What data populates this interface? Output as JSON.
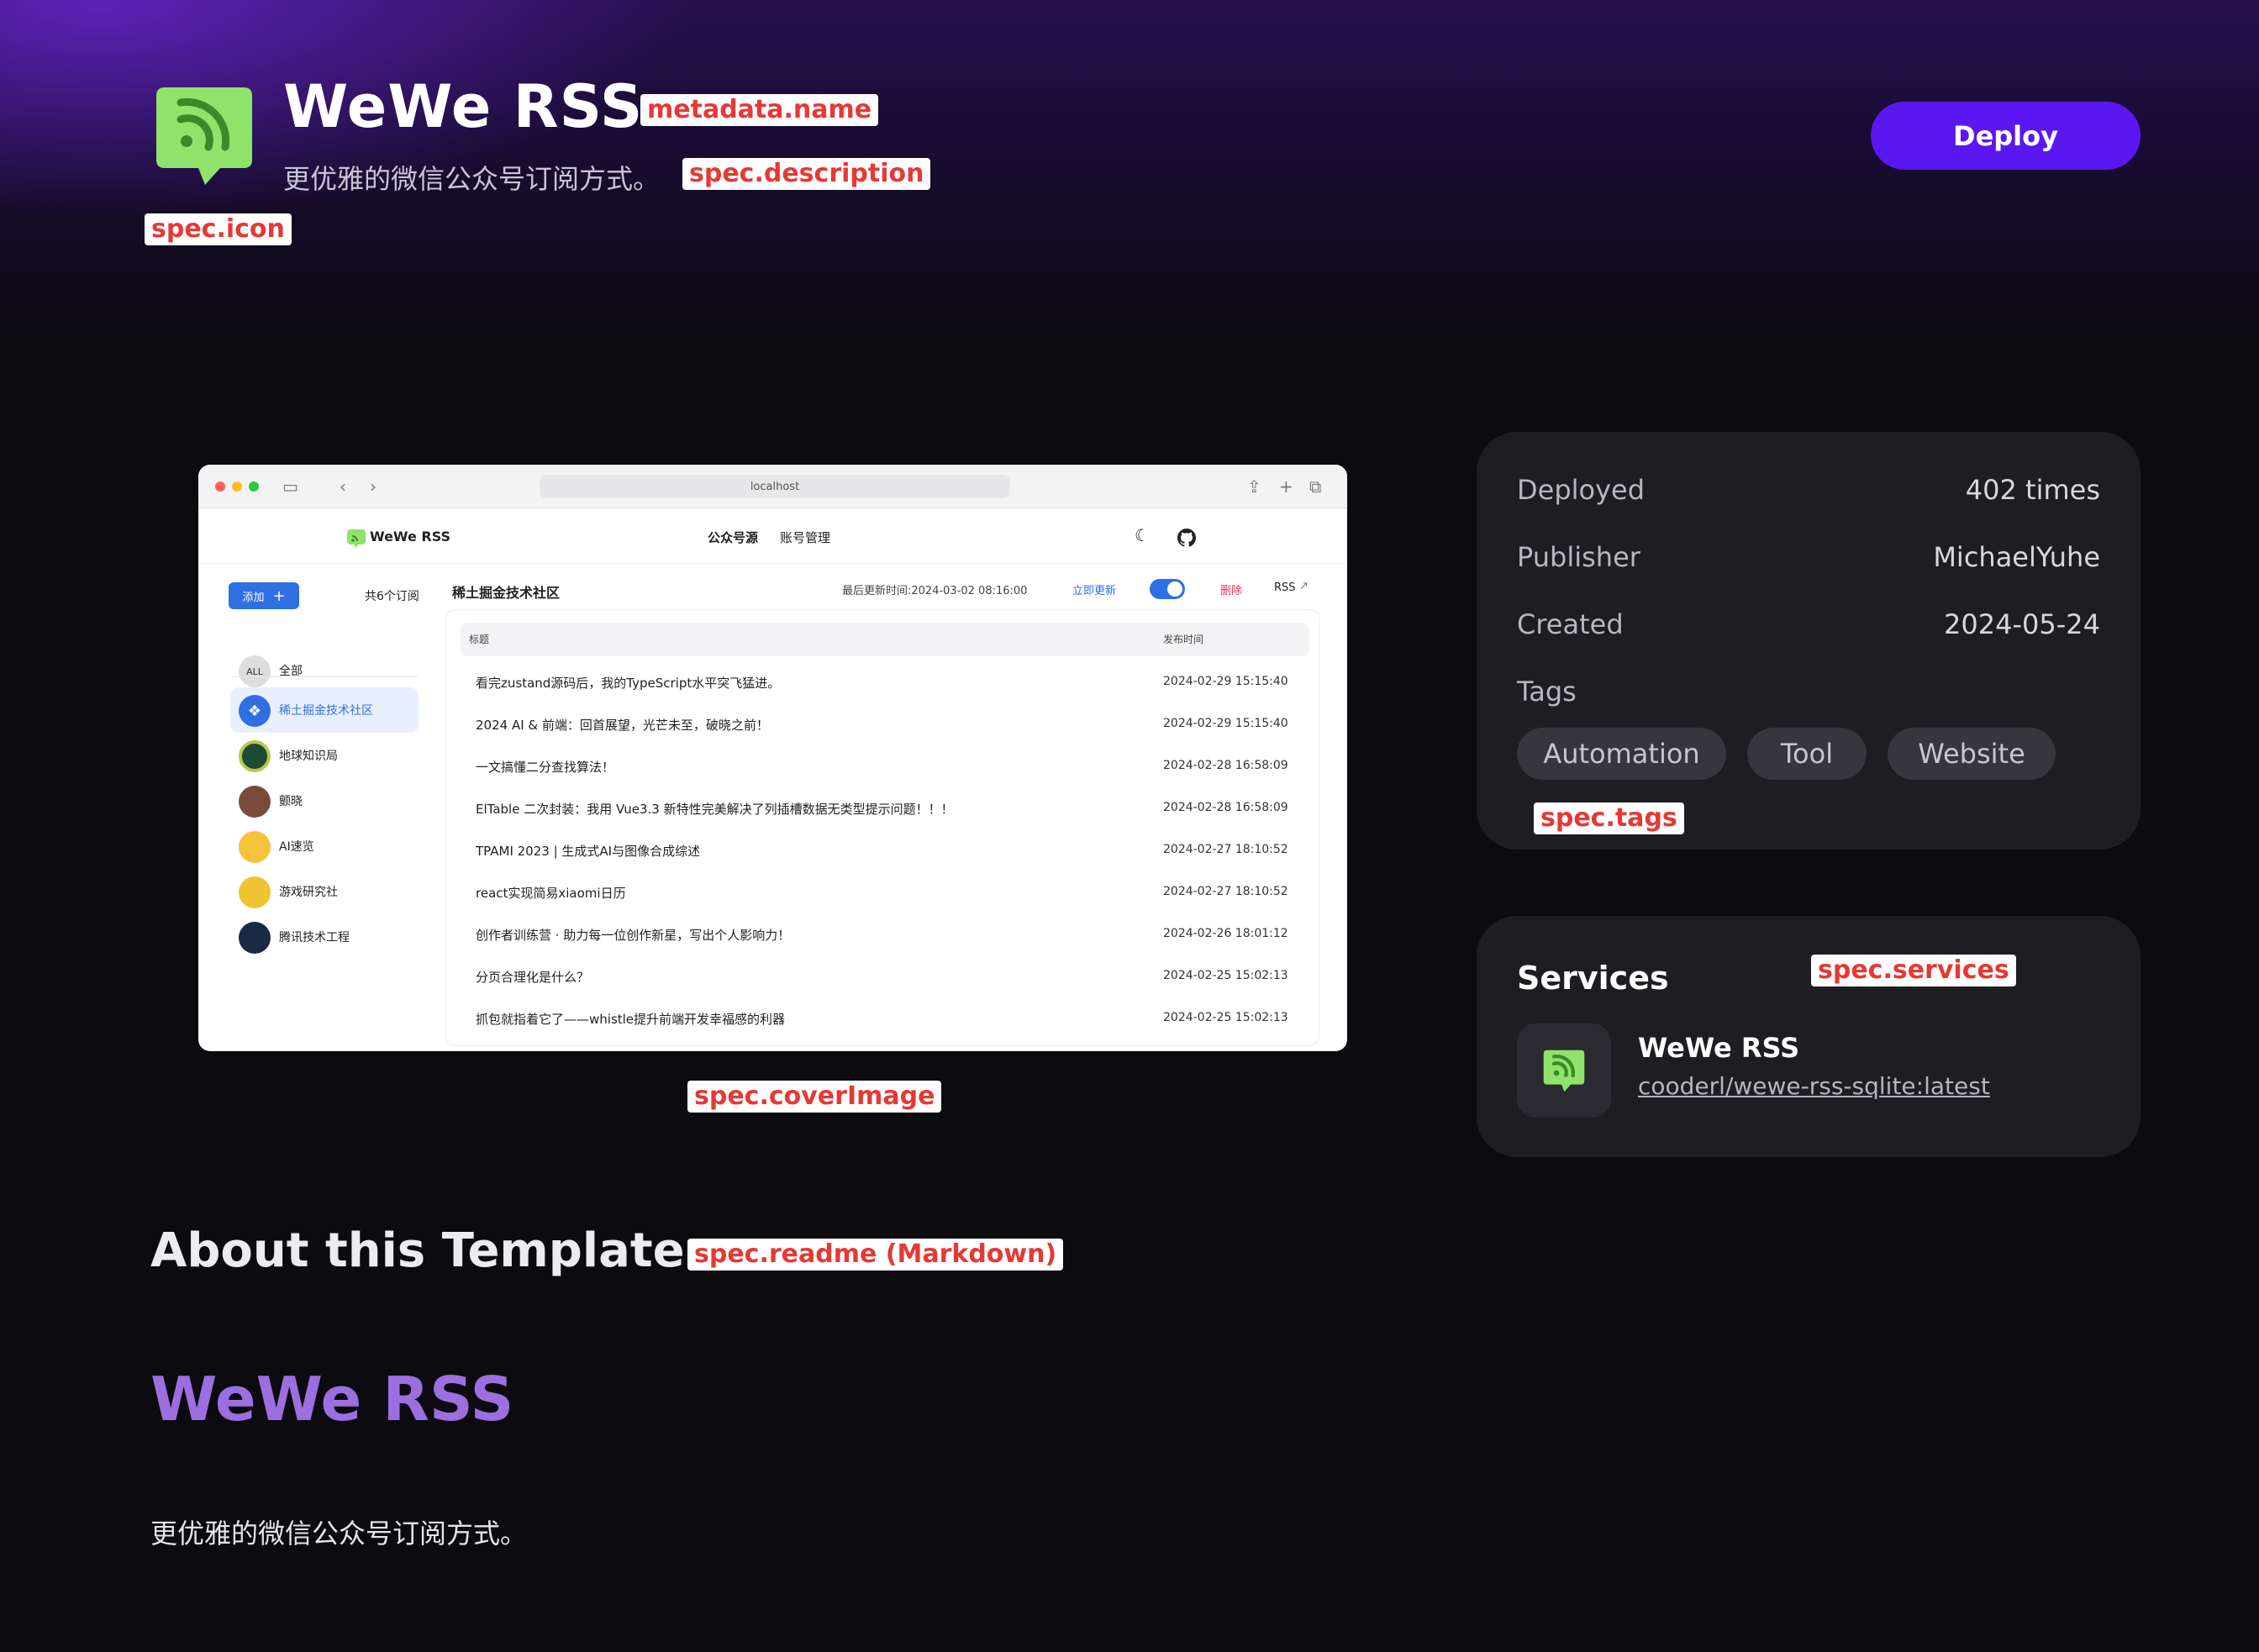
{
  "header": {
    "title": "WeWe RSS",
    "description": "更优雅的微信公众号订阅方式。",
    "deploy_label": "Deploy"
  },
  "annotations": {
    "name": "metadata.name",
    "description": "spec.description",
    "icon": "spec.icon",
    "cover": "spec.coverImage",
    "tags": "spec.tags",
    "services": "spec.services",
    "readme": "spec.readme (Markdown)"
  },
  "cover": {
    "address": "localhost",
    "app_name": "WeWe RSS",
    "nav_sources": "公众号源",
    "nav_accounts": "账号管理",
    "add_label": "添加",
    "subs_count": "共6个订阅",
    "all_badge": "ALL",
    "all_label": "全部",
    "feeds": [
      {
        "label": "稀土掘金技术社区"
      },
      {
        "label": "地球知识局"
      },
      {
        "label": "颤晓"
      },
      {
        "label": "AI速览"
      },
      {
        "label": "游戏研究社"
      },
      {
        "label": "腾讯技术工程"
      }
    ],
    "current_feed": "稀土掘金技术社区",
    "last_update": "最后更新时间:2024-03-02 08:16:00",
    "update_now": "立即更新",
    "delete_label": "删除",
    "rss_label": "RSS",
    "col_title": "标题",
    "col_time": "发布时间",
    "rows": [
      {
        "title": "看完zustand源码后，我的TypeScript水平突飞猛进。",
        "time": "2024-02-29 15:15:40"
      },
      {
        "title": "2024 AI & 前端：回首展望，光芒未至，破晓之前！",
        "time": "2024-02-29 15:15:40"
      },
      {
        "title": "一文搞懂二分查找算法！",
        "time": "2024-02-28 16:58:09"
      },
      {
        "title": "ElTable 二次封装：我用 Vue3.3 新特性完美解决了列插槽数据无类型提示问题！！！",
        "time": "2024-02-28 16:58:09"
      },
      {
        "title": "TPAMI 2023 | 生成式AI与图像合成综述",
        "time": "2024-02-27 18:10:52"
      },
      {
        "title": "react实现简易xiaomi日历",
        "time": "2024-02-27 18:10:52"
      },
      {
        "title": "创作者训练营 · 助力每一位创作新星，写出个人影响力！",
        "time": "2024-02-26 18:01:12"
      },
      {
        "title": "分页合理化是什么？",
        "time": "2024-02-25 15:02:13"
      },
      {
        "title": "抓包就指着它了——whistle提升前端开发幸福感的利器",
        "time": "2024-02-25 15:02:13"
      }
    ]
  },
  "info": {
    "deployed_label": "Deployed",
    "deployed_value": "402 times",
    "publisher_label": "Publisher",
    "publisher_value": "MichaelYuhe",
    "created_label": "Created",
    "created_value": "2024-05-24",
    "tags_label": "Tags",
    "tags": [
      "Automation",
      "Tool",
      "Website"
    ]
  },
  "services": {
    "title": "Services",
    "name": "WeWe RSS",
    "image": "cooderl/wewe-rss-sqlite:latest"
  },
  "readme": {
    "section_title": "About this Template",
    "h1": "WeWe RSS",
    "paragraph": "更优雅的微信公众号订阅方式。"
  },
  "colors": {
    "accent": "#5a17f2",
    "icon_green": "#8fe36a",
    "readme_heading": "#9c6fe0",
    "annotation_text": "#e53935"
  },
  "icons": [
    "rss-icon",
    "moon-icon",
    "github-icon",
    "external-link-icon",
    "plus-icon",
    "toggle-icon"
  ]
}
